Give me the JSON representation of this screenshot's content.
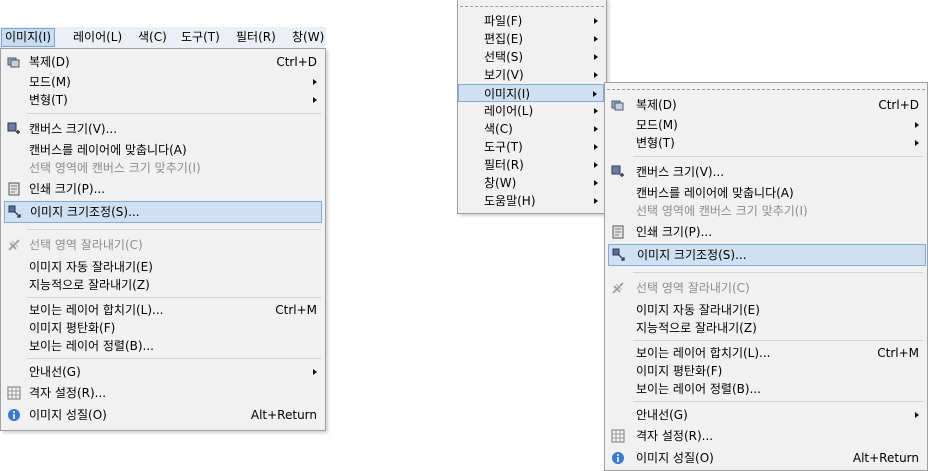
{
  "menubar": {
    "items": [
      "이미지(I)",
      "레이어(L)",
      "색(C)",
      "도구(T)",
      "필터(R)",
      "창(W)"
    ]
  },
  "image_menu": {
    "items": [
      {
        "label": "복제(D)",
        "accel": "Ctrl+D"
      },
      {
        "label": "모드(M)"
      },
      {
        "label": "변형(T)"
      },
      {
        "label": "캔버스 크기(V)..."
      },
      {
        "label": "캔버스를 레이어에 맞춥니다(A)"
      },
      {
        "label": "선택 영역에 캔버스 크기 맞추기(I)"
      },
      {
        "label": "인쇄 크기(P)..."
      },
      {
        "label": "이미지 크기조정(S)..."
      },
      {
        "label": "선택 영역 잘라내기(C)"
      },
      {
        "label": "이미지 자동 잘라내기(E)"
      },
      {
        "label": "지능적으로 잘라내기(Z)"
      },
      {
        "label": "보이는 레이어 합치기(L)...",
        "accel": "Ctrl+M"
      },
      {
        "label": "이미지 평탄화(F)"
      },
      {
        "label": "보이는 레이어 정렬(B)..."
      },
      {
        "label": "안내선(G)"
      },
      {
        "label": "격자 설정(R)..."
      },
      {
        "label": "이미지 성질(O)",
        "accel": "Alt+Return"
      }
    ]
  },
  "top_menu": {
    "items": [
      "파일(F)",
      "편집(E)",
      "선택(S)",
      "보기(V)",
      "이미지(I)",
      "레이어(L)",
      "색(C)",
      "도구(T)",
      "필터(R)",
      "창(W)",
      "도움말(H)"
    ]
  },
  "colors": {
    "highlight": "#cfe0f3",
    "highlight_border": "#84acd8",
    "menu_bg": "#f1f1f1",
    "disabled": "#8d8d8d"
  }
}
